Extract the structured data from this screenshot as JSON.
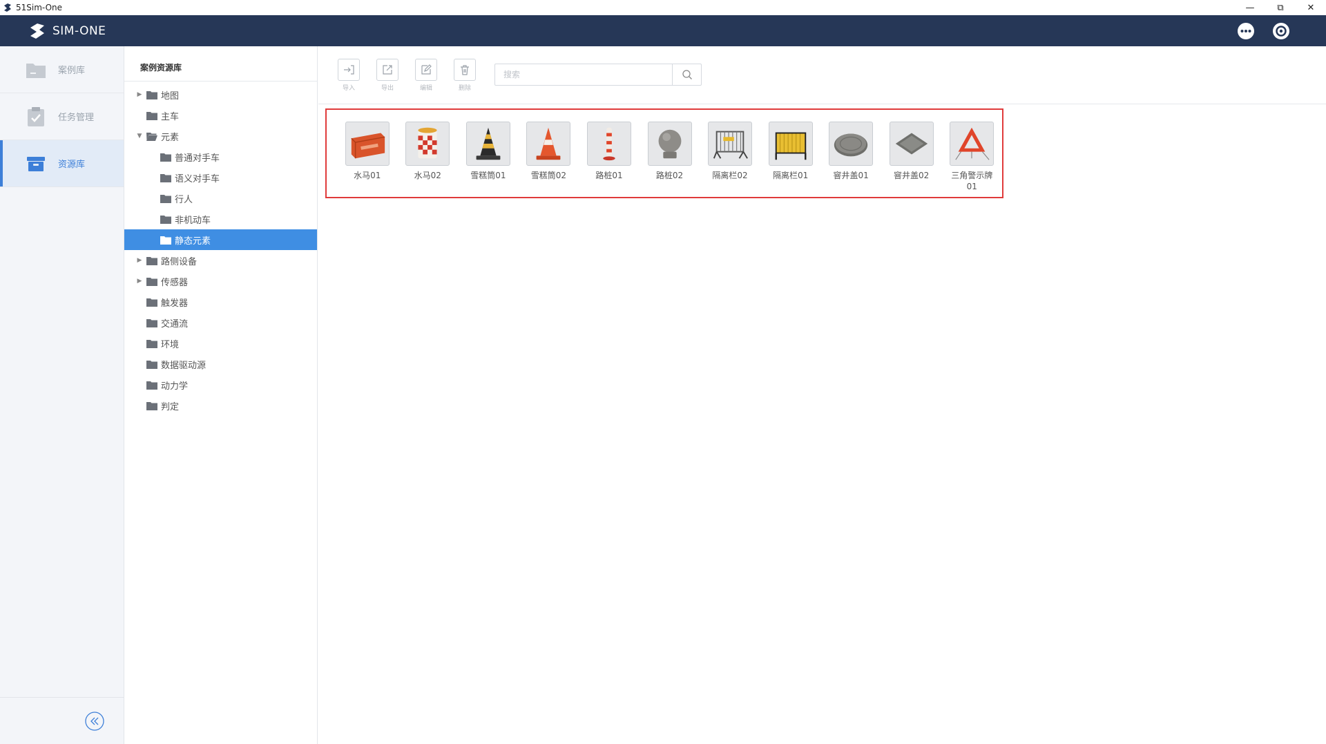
{
  "window": {
    "title": "51Sim-One"
  },
  "header": {
    "brand": "SIM-ONE"
  },
  "leftnav": {
    "items": [
      {
        "label": "案例库",
        "icon": "folder-icon",
        "active": false
      },
      {
        "label": "任务管理",
        "icon": "clipboard-check-icon",
        "active": false
      },
      {
        "label": "资源库",
        "icon": "storage-box-icon",
        "active": true
      }
    ]
  },
  "tree": {
    "title": "案例资源库",
    "items": [
      {
        "label": "地图",
        "level": 0,
        "caret": "collapsed",
        "selected": false
      },
      {
        "label": "主车",
        "level": 0,
        "caret": "none",
        "selected": false
      },
      {
        "label": "元素",
        "level": 0,
        "caret": "expanded",
        "selected": false
      },
      {
        "label": "普通对手车",
        "level": 1,
        "caret": "none",
        "selected": false
      },
      {
        "label": "语义对手车",
        "level": 1,
        "caret": "none",
        "selected": false
      },
      {
        "label": "行人",
        "level": 1,
        "caret": "none",
        "selected": false
      },
      {
        "label": "非机动车",
        "level": 1,
        "caret": "none",
        "selected": false
      },
      {
        "label": "静态元素",
        "level": 1,
        "caret": "none",
        "selected": true
      },
      {
        "label": "路侧设备",
        "level": 0,
        "caret": "collapsed",
        "selected": false
      },
      {
        "label": "传感器",
        "level": 0,
        "caret": "collapsed",
        "selected": false
      },
      {
        "label": "触发器",
        "level": 0,
        "caret": "none",
        "selected": false
      },
      {
        "label": "交通流",
        "level": 0,
        "caret": "none",
        "selected": false
      },
      {
        "label": "环境",
        "level": 0,
        "caret": "none",
        "selected": false
      },
      {
        "label": "数据驱动源",
        "level": 0,
        "caret": "none",
        "selected": false
      },
      {
        "label": "动力学",
        "level": 0,
        "caret": "none",
        "selected": false
      },
      {
        "label": "判定",
        "level": 0,
        "caret": "none",
        "selected": false
      }
    ]
  },
  "toolbar": {
    "import_label": "导入",
    "export_label": "导出",
    "edit_label": "编辑",
    "delete_label": "删除",
    "search_placeholder": "搜索"
  },
  "assets": [
    {
      "name": "水马01",
      "icon": "water-barrier-icon"
    },
    {
      "name": "水马02",
      "icon": "water-barrel-icon"
    },
    {
      "name": "雪糕筒01",
      "icon": "traffic-cone-black-yellow-icon"
    },
    {
      "name": "雪糕筒02",
      "icon": "traffic-cone-orange-icon"
    },
    {
      "name": "路桩01",
      "icon": "bollard-post-icon"
    },
    {
      "name": "路桩02",
      "icon": "stone-ball-bollard-icon"
    },
    {
      "name": "隔离栏02",
      "icon": "metal-fence-icon"
    },
    {
      "name": "隔离栏01",
      "icon": "yellow-fence-icon"
    },
    {
      "name": "窨井盖01",
      "icon": "round-manhole-cover-icon"
    },
    {
      "name": "窨井盖02",
      "icon": "square-manhole-cover-icon"
    },
    {
      "name": "三角警示牌01",
      "icon": "warning-triangle-icon"
    }
  ],
  "colors": {
    "header_bg": "#263757",
    "accent": "#3d7fd8",
    "tree_selected": "#3f8ee3",
    "highlight_border": "#e03a3a"
  }
}
